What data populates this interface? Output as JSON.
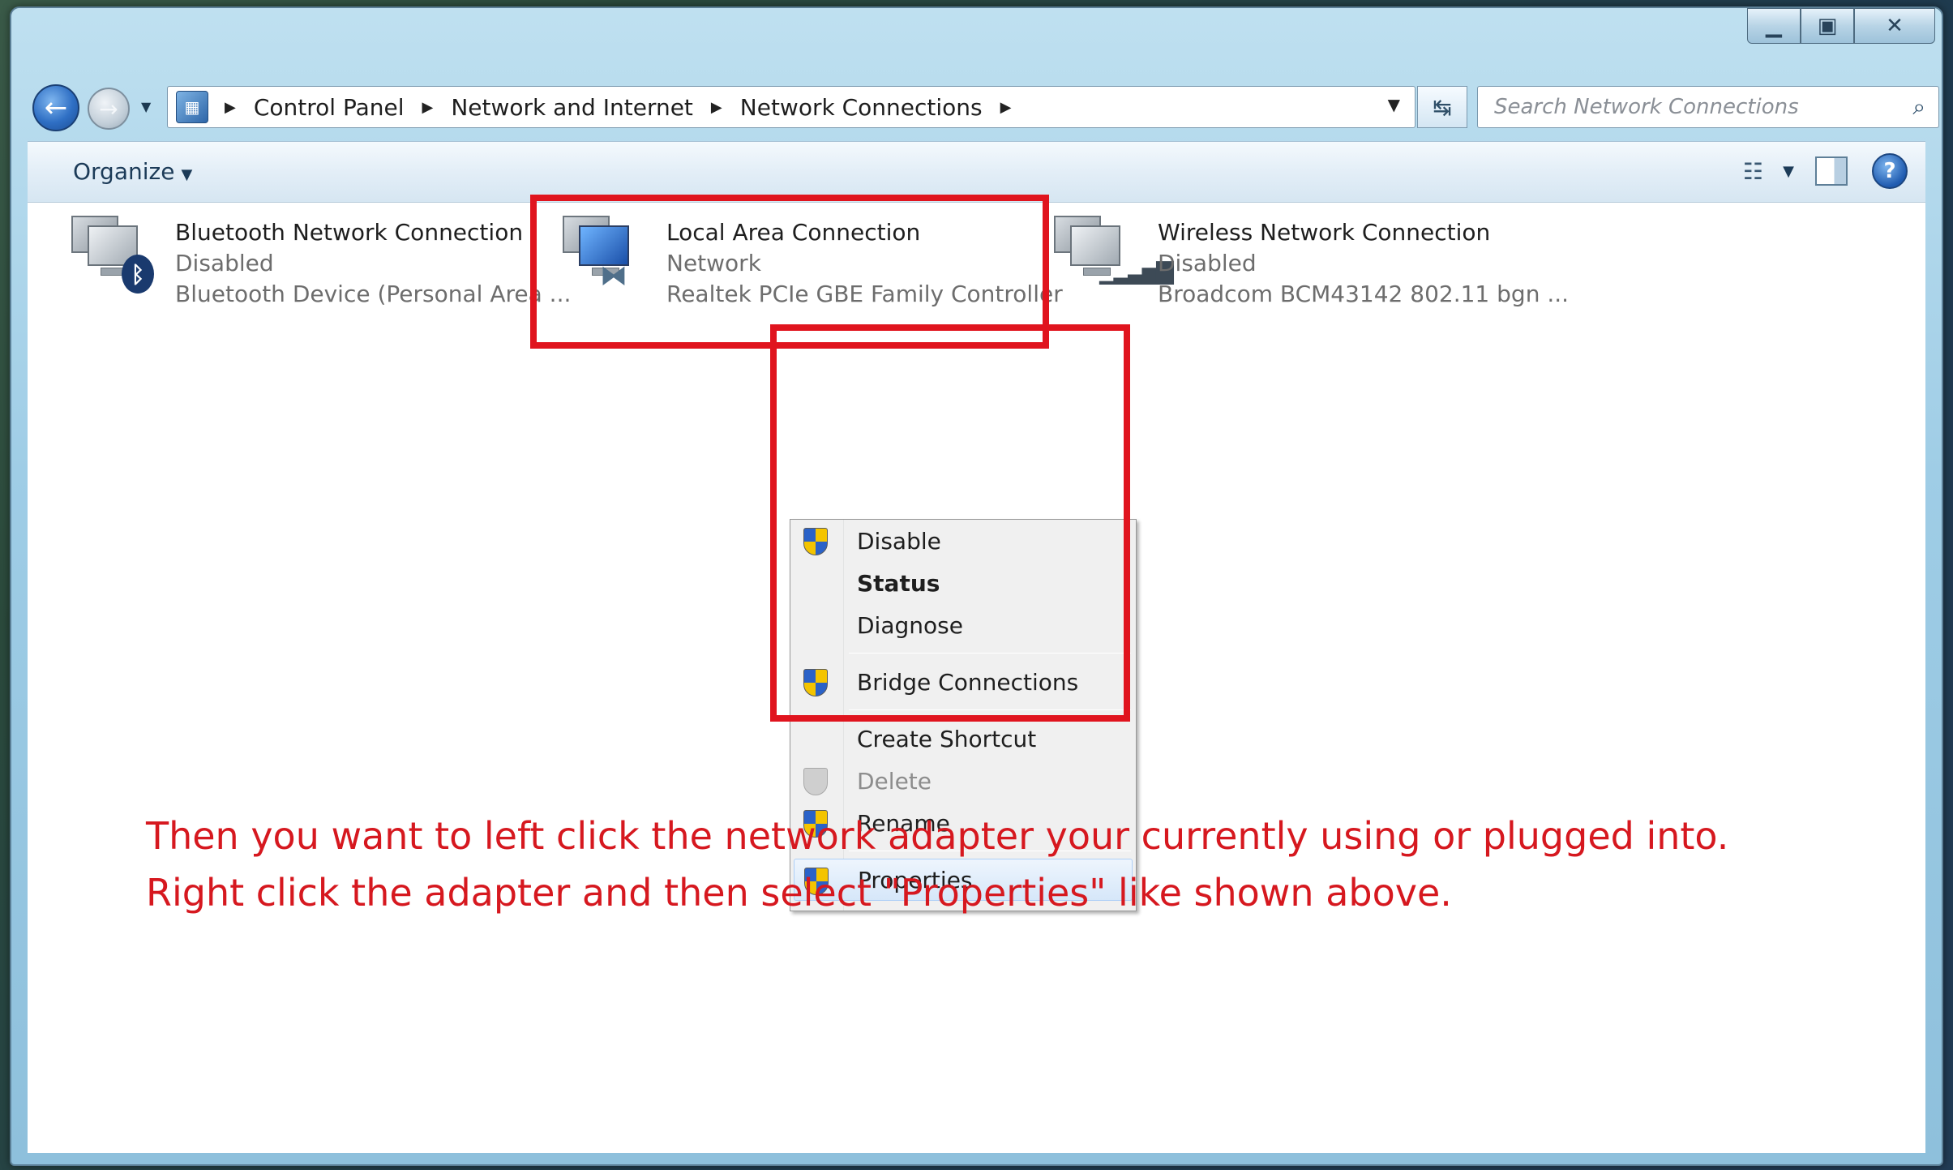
{
  "window": {
    "caption_min": "▁",
    "caption_max": "▣",
    "caption_close": "✕"
  },
  "address": {
    "crumbs": [
      "Control Panel",
      "Network and Internet",
      "Network Connections"
    ],
    "search_placeholder": "Search Network Connections"
  },
  "toolbar": {
    "organize_label": "Organize",
    "help_label": "?"
  },
  "adapters": [
    {
      "name": "Bluetooth Network Connection",
      "status": "Disabled",
      "device": "Bluetooth Device (Personal Area ...",
      "icon": "bluetooth-icon"
    },
    {
      "name": "Local Area Connection",
      "status": "Network",
      "device": "Realtek PCIe GBE Family Controller",
      "icon": "ethernet-icon"
    },
    {
      "name": "Wireless Network Connection",
      "status": "Disabled",
      "device": "Broadcom BCM43142 802.11 bgn ...",
      "icon": "wifi-signal-icon"
    }
  ],
  "context_menu": {
    "items": [
      {
        "label": "Disable",
        "shield": true
      },
      {
        "label": "Status",
        "bold": true
      },
      {
        "label": "Diagnose"
      },
      {
        "label": "Bridge Connections",
        "shield": true
      },
      {
        "label": "Create Shortcut"
      },
      {
        "label": "Delete",
        "shield": true,
        "disabled": true
      },
      {
        "label": "Rename",
        "shield": true
      },
      {
        "label": "Properties",
        "shield": true,
        "highlighted": true
      }
    ]
  },
  "instructions": {
    "line1": "Then you want to left click the network adapter your currently using or plugged into.",
    "line2": "Right click the adapter and then select \"Properties\" like shown above."
  },
  "colors": {
    "highlight_box": "#e0141e",
    "instruction_text": "#d6181f"
  }
}
